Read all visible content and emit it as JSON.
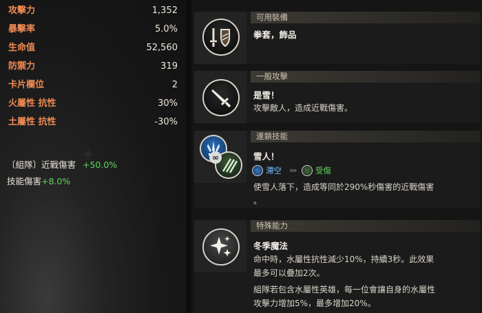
{
  "stats": [
    {
      "label": "攻擊力",
      "value": "1,352"
    },
    {
      "label": "暴擊率",
      "value": "5.0%"
    },
    {
      "label": "生命值",
      "value": "52,560"
    },
    {
      "label": "防禦力",
      "value": "319"
    },
    {
      "label": "卡片欄位",
      "value": "2"
    },
    {
      "label": "火屬性 抗性",
      "value": "30%"
    },
    {
      "label": "土屬性 抗性",
      "value": "-30%"
    }
  ],
  "bonuses": [
    {
      "label": "〔組隊〕近戰傷害",
      "value": "+50.0%"
    },
    {
      "label": "技能傷害",
      "value": "+8.0%"
    }
  ],
  "sections": {
    "equip": {
      "header": "可用裝備",
      "title": "拳套，飾品"
    },
    "attack": {
      "header": "一般攻擊",
      "title": "是雪！",
      "desc": "攻擊敵人，造成近戰傷害。"
    },
    "chain": {
      "header": "連鎖技能",
      "title": "雪人！",
      "status_from": "滯空",
      "arrows": "»»",
      "status_to": "受傷",
      "desc_line1": "使雪人落下，造成等同於290%秒傷害的近戰傷害",
      "desc_line2": "。"
    },
    "special": {
      "header": "特殊能力",
      "title": "冬季魔法",
      "desc": [
        "命中時，水屬性抗性減少10%，持續3秒。此效果",
        "最多可以疊加2次。",
        "組隊若包含水屬性英雄，每一位會讓自身的水屬性",
        "攻擊力增加5%，最多增加20%。"
      ]
    }
  },
  "colors": {
    "stat_label": "#ef8a53",
    "bonus_positive": "#5fd65f",
    "status_from": "#6fc3ff",
    "status_to": "#5fd65f"
  },
  "icons": {
    "equip": "sword-shield-icon",
    "attack": "sword-icon",
    "chain_primary": "blue-spikes-icon",
    "chain_secondary": "green-claws-icon",
    "special": "sparkle-icon"
  }
}
